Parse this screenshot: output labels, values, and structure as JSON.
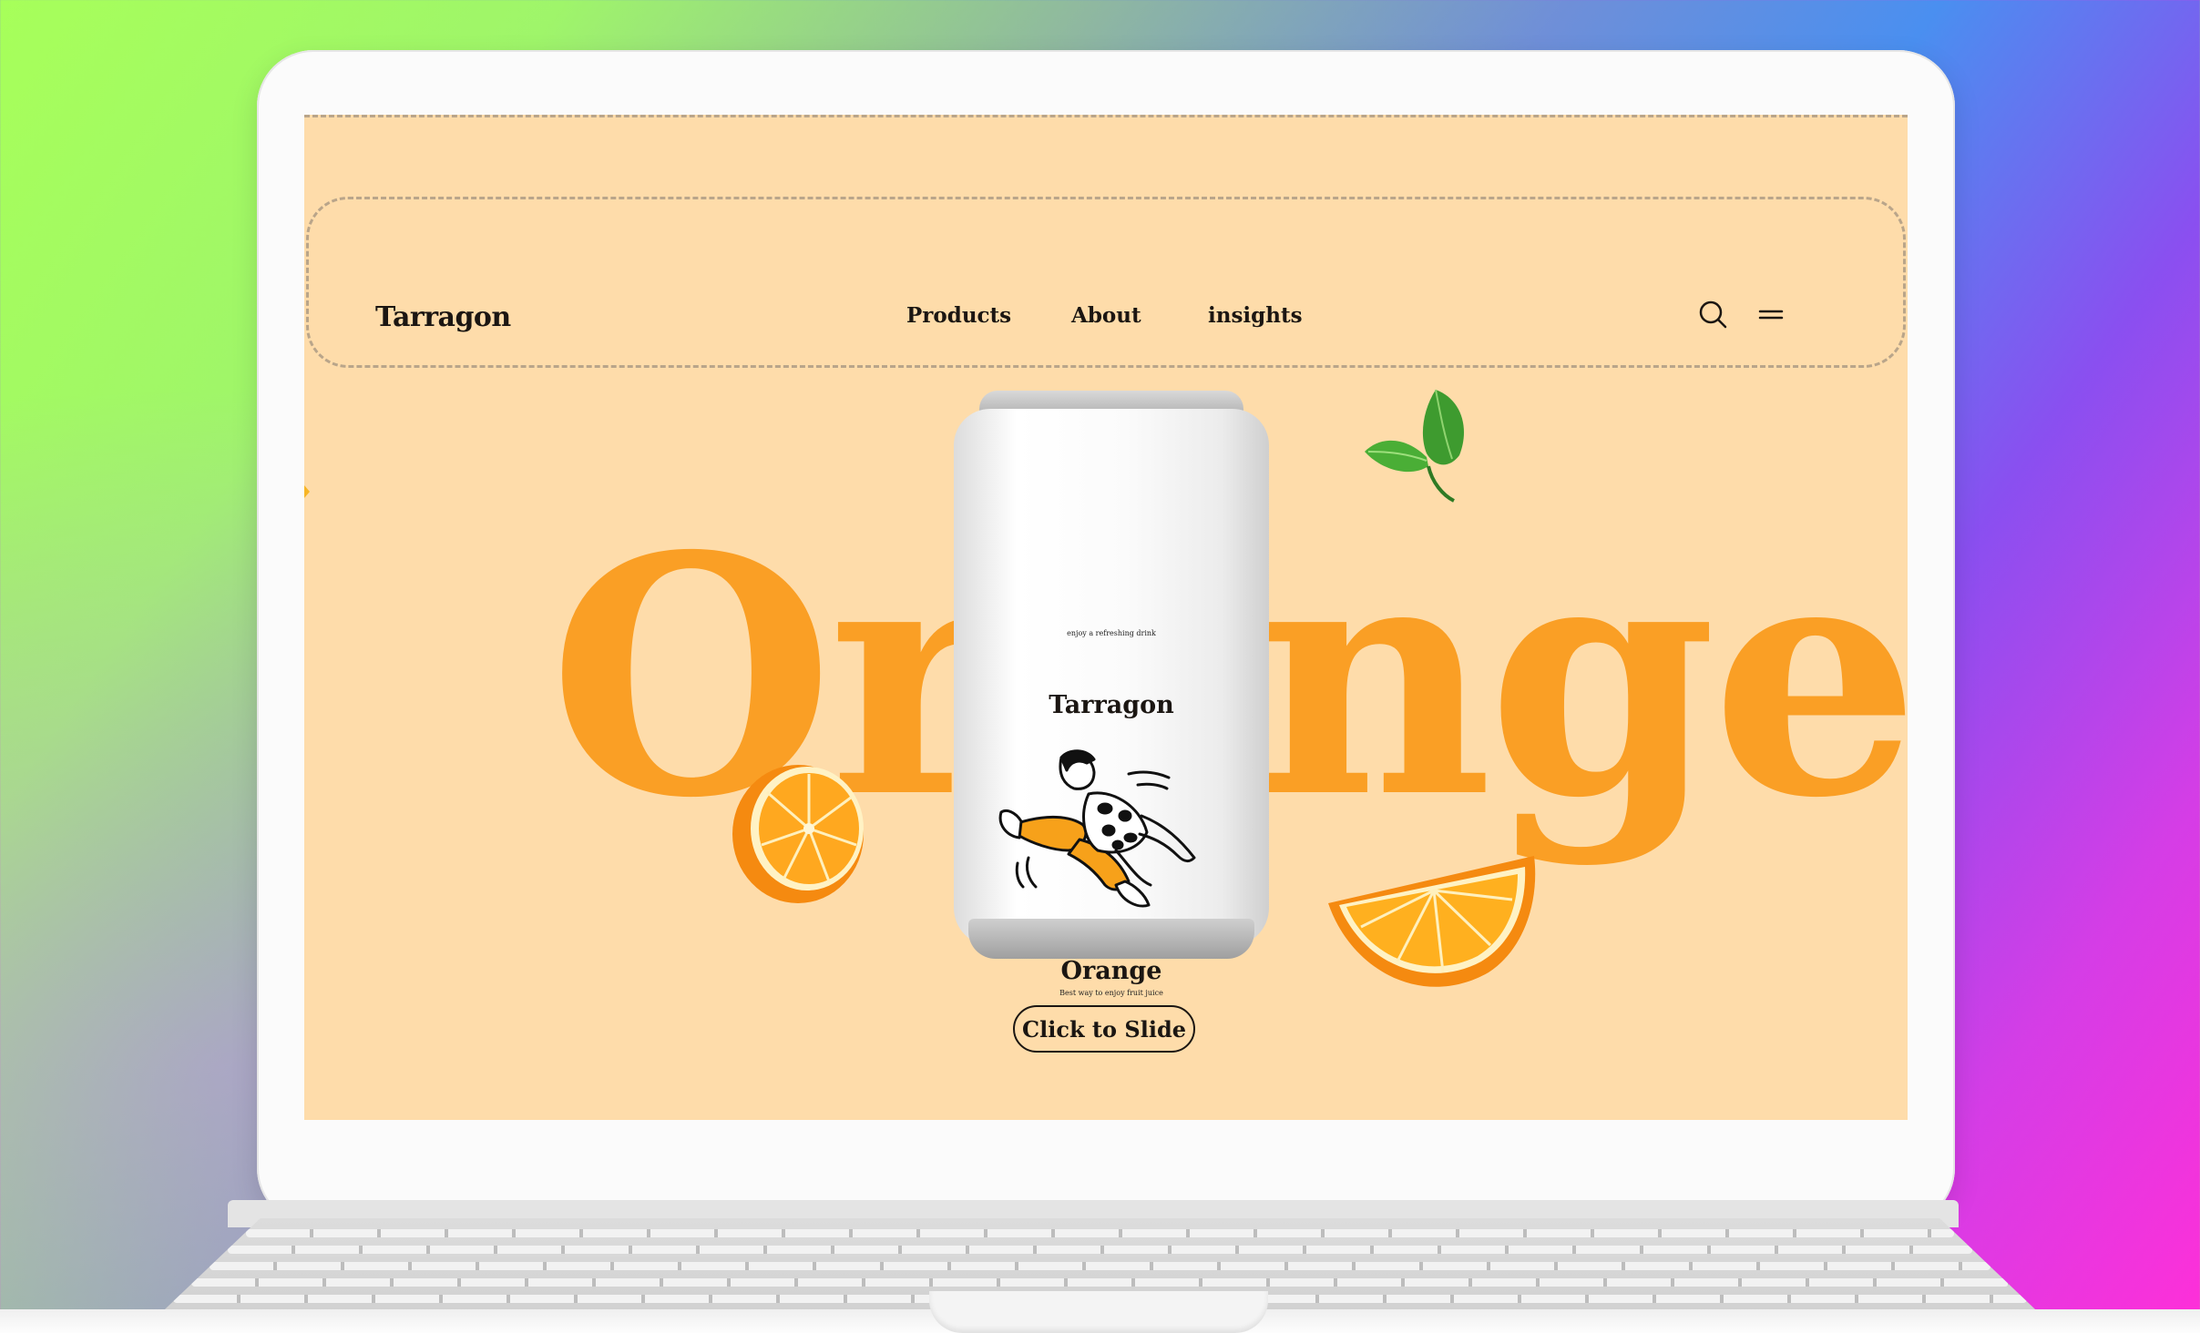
{
  "brand": {
    "logo": "Tarragon"
  },
  "nav": {
    "items": [
      {
        "label": "Products"
      },
      {
        "label": "About"
      },
      {
        "label": "insights"
      }
    ]
  },
  "header_icons": [
    "search-icon",
    "menu-icon"
  ],
  "hero": {
    "word_left": "Or",
    "word_right": "nge",
    "full_word": "Orange",
    "cta_label": "Click to Slide"
  },
  "can": {
    "tagline": "enjoy a refreshing drink",
    "brand": "Tarragon",
    "flavor": "Orange",
    "subline": "Best way to enjoy fruit juice"
  },
  "colors": {
    "background": "#fedcaa",
    "accent_orange": "#fa9f25",
    "text_dark": "#1b1612"
  }
}
